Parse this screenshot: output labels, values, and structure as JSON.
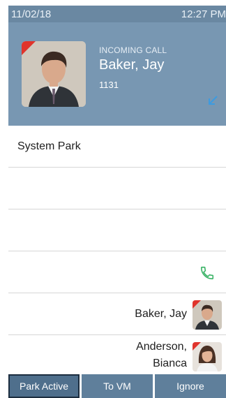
{
  "status_bar": {
    "date": "11/02/18",
    "time": "12:27 PM"
  },
  "incoming_call": {
    "label": "INCOMING CALL",
    "name": "Baker, Jay",
    "extension": "1131"
  },
  "lines": [
    {
      "label": "System Park"
    },
    {
      "label": ""
    },
    {
      "label": ""
    },
    {
      "label": "",
      "icon": "phone-icon"
    }
  ],
  "contacts": [
    {
      "name": "Baker, Jay",
      "photo": "man-portrait"
    },
    {
      "name_line1": "Anderson,",
      "name_line2": "Bianca",
      "photo": "woman-portrait"
    }
  ],
  "softkeys": {
    "park_active": "Park Active",
    "to_vm": "To VM",
    "ignore": "Ignore"
  },
  "colors": {
    "status_bar": "#6a88a2",
    "call_card": "#7897b2",
    "softkey": "#5f7f9b",
    "accent_green": "#3fb56a",
    "presence_red": "#e0342c"
  }
}
